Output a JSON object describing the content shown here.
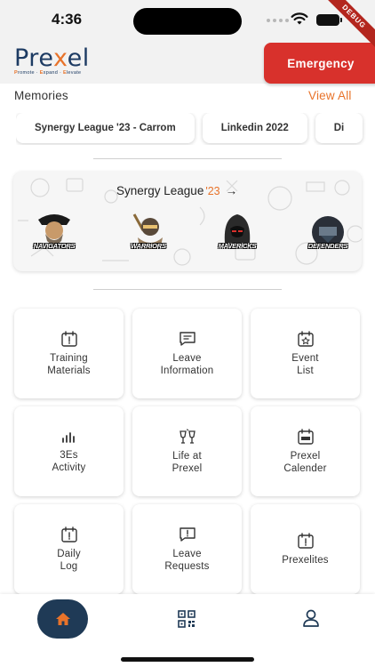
{
  "status_bar": {
    "time": "4:36",
    "debug_label": "DEBUG"
  },
  "header": {
    "logo": {
      "text_start": "Pre",
      "text_x": "x",
      "text_end": "el",
      "tagline_parts": [
        "P",
        "romote · ",
        "E",
        "xpand · ",
        "E",
        "levate"
      ]
    },
    "emergency_label": "Emergency"
  },
  "memories": {
    "title": "Memories",
    "view_all": "View All",
    "chips": [
      "Synergy League '23 - Carrom",
      "Linkedin 2022",
      "Di"
    ]
  },
  "banner": {
    "title": "Synergy League",
    "year": "'23",
    "arrow": "→",
    "teams": [
      "NAVIGATORS",
      "WARRIORS",
      "MAVERICKS",
      "DEFENDERS"
    ]
  },
  "tiles": [
    {
      "label": "Training\nMaterials",
      "icon": "calendar-alert-icon"
    },
    {
      "label": "Leave\nInformation",
      "icon": "message-icon"
    },
    {
      "label": "Event\nList",
      "icon": "calendar-star-icon"
    },
    {
      "label": "3Es\nActivity",
      "icon": "bar-chart-icon"
    },
    {
      "label": "Life at\nPrexel",
      "icon": "cheers-icon"
    },
    {
      "label": "Prexel\nCalender",
      "icon": "calendar-prexel-icon"
    },
    {
      "label": "Daily\nLog",
      "icon": "calendar-alert-icon"
    },
    {
      "label": "Leave\nRequests",
      "icon": "message-alert-icon"
    },
    {
      "label": "Prexelites",
      "icon": "calendar-alert-icon"
    }
  ],
  "nav": {
    "items": [
      "home-icon",
      "qr-code-icon",
      "profile-icon"
    ]
  },
  "colors": {
    "accent": "#e8732a",
    "emergency": "#d8312c",
    "navy": "#1f3a56"
  }
}
